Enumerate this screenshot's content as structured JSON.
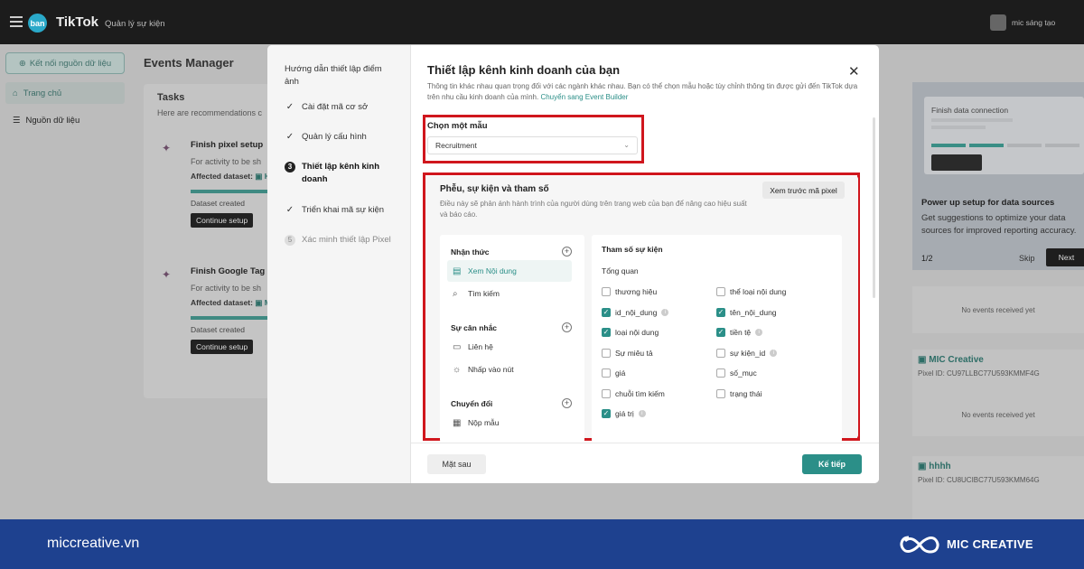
{
  "topbar": {
    "badge": "ban",
    "logo": "TikTok",
    "subtitle": "Quản lý sự kiện",
    "user_name": "mic sáng tạo",
    "menu_icon": "hamburger-icon"
  },
  "sidebar": {
    "connect_button": "Kết nối nguồn dữ liệu",
    "items": [
      {
        "label": "Trang chủ",
        "icon": "home-icon"
      },
      {
        "label": "Nguồn dữ liệu",
        "icon": "list-icon"
      }
    ]
  },
  "main": {
    "title": "Events Manager",
    "tasks": {
      "title": "Tasks",
      "subtitle": "Here are recommendations c",
      "items": [
        {
          "title": "Finish pixel setup",
          "desc": "For activity to be sh",
          "affected": "Affected dataset:",
          "affected_value": "H",
          "status": "Dataset created",
          "button": "Continue setup"
        },
        {
          "title": "Finish Google Tag M",
          "desc": "For activity to be sh",
          "affected": "Affected dataset:",
          "affected_value": "M",
          "status": "Dataset created",
          "button": "Continue setup"
        }
      ]
    }
  },
  "right_panel": {
    "preview_title": "Finish data connection",
    "heading": "Power up setup for data sources",
    "desc": "Get suggestions to optimize your data sources for improved reporting accuracy.",
    "page": "1/2",
    "skip": "Skip",
    "next": "Next",
    "no_events": "No events received yet",
    "pixels": [
      {
        "name": "MIC Creative",
        "id": "Pixel ID: CU97LLBC77U593KMMF4G"
      },
      {
        "name": "hhhh",
        "id": "Pixel ID: CU8UCIBC77U593KMM64G"
      }
    ]
  },
  "modal": {
    "steps_title": "Hướng dẫn thiết lập điểm ảnh",
    "steps": [
      {
        "label": "Cài đặt mã cơ sở",
        "state": "done",
        "marker": "✓"
      },
      {
        "label": "Quản lý cấu hình",
        "state": "done",
        "marker": "✓"
      },
      {
        "label": "Thiết lập kênh kinh doanh",
        "state": "current",
        "marker": "3"
      },
      {
        "label": "Triển khai mã sự kiện",
        "state": "done",
        "marker": "✓"
      },
      {
        "label": "Xác minh thiết lập Pixel",
        "state": "pending",
        "marker": "5"
      }
    ],
    "title": "Thiết lập kênh kinh doanh của bạn",
    "close_icon": "close-icon",
    "desc": "Thông tin khác nhau quan trọng đối với các ngành khác nhau. Bạn có thể chọn mẫu hoặc tùy chỉnh thông tin được gửi đến TikTok dựa trên nhu cầu kinh doanh của mình.",
    "desc_link": "Chuyển sang Event Builder",
    "template": {
      "label": "Chọn một mẫu",
      "value": "Recruitment"
    },
    "funnel": {
      "title": "Phễu, sự kiện và tham số",
      "desc": "Điều này sẽ phản ánh hành trình của người dùng trên trang web của bạn để nâng cao hiệu suất và báo cáo.",
      "preview_button": "Xem trước mã pixel",
      "groups": [
        {
          "label": "Nhận thức",
          "items": [
            {
              "label": "Xem Nội dung",
              "icon": "content-icon",
              "selected": true
            },
            {
              "label": "Tìm kiếm",
              "icon": "search-icon",
              "selected": false
            }
          ]
        },
        {
          "label": "Sự cân nhắc",
          "items": [
            {
              "label": "Liên hệ",
              "icon": "chat-icon",
              "selected": false
            },
            {
              "label": "Nhấp vào nút",
              "icon": "click-icon",
              "selected": false
            }
          ]
        },
        {
          "label": "Chuyển đổi",
          "items": [
            {
              "label": "Nộp mẫu",
              "icon": "form-icon",
              "selected": false
            }
          ]
        }
      ],
      "params_title": "Tham số sự kiện",
      "params_section": "Tổng quan",
      "params_left": [
        {
          "label": "thương hiệu",
          "checked": false,
          "info": false
        },
        {
          "label": "id_nội_dung",
          "checked": true,
          "info": true
        },
        {
          "label": "loại nội dung",
          "checked": true,
          "info": false
        },
        {
          "label": "Sự miêu tả",
          "checked": false,
          "info": false
        },
        {
          "label": "giá",
          "checked": false,
          "info": false
        },
        {
          "label": "chuỗi tìm kiếm",
          "checked": false,
          "info": false
        },
        {
          "label": "giá trị",
          "checked": true,
          "info": true
        }
      ],
      "params_right": [
        {
          "label": "thể loại nội dung",
          "checked": false,
          "info": false
        },
        {
          "label": "tên_nội_dung",
          "checked": true,
          "info": false
        },
        {
          "label": "tiền tệ",
          "checked": true,
          "info": true
        },
        {
          "label": "sự kiện_id",
          "checked": false,
          "info": true
        },
        {
          "label": "số_mục",
          "checked": false,
          "info": false
        },
        {
          "label": "trạng thái",
          "checked": false,
          "info": false
        }
      ]
    },
    "later_button": "Mặt sau",
    "next_button": "Kế tiếp"
  },
  "footer": {
    "site": "miccreative.vn",
    "brand": "MIC CREATIVE",
    "logo_icon": "infinity-logo-icon"
  },
  "colors": {
    "accent": "#2b8f88",
    "highlight": "#d0161d",
    "footer": "#1e418f"
  }
}
